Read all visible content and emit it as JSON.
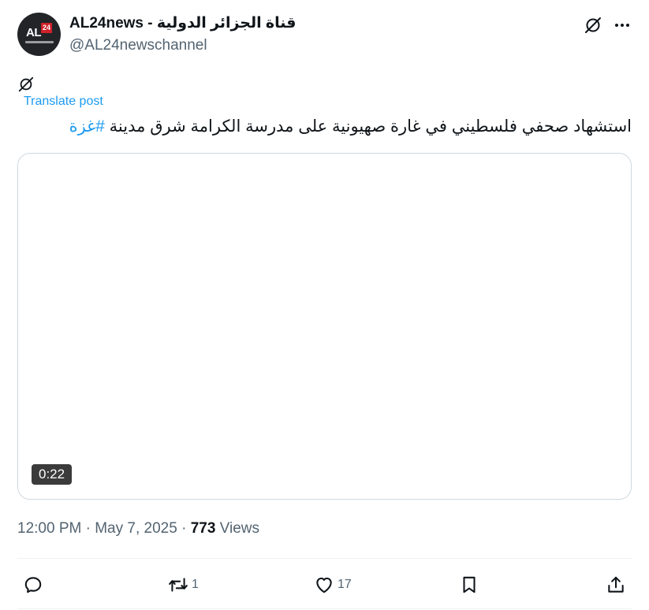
{
  "author": {
    "avatar_text": "AL",
    "avatar_badge": "24",
    "display_name": "AL24news - قناة الجزائر الدولية",
    "handle": "@AL24newschannel"
  },
  "post": {
    "translate_label": "Translate post",
    "text_main": "استشهاد صحفي فلسطيني في غارة صهيونية على مدرسة الكرامة شرق مدينة ",
    "hashtag": "#غزة"
  },
  "media": {
    "duration": "0:22"
  },
  "meta": {
    "time": "12:00 PM",
    "separator": "·",
    "date": "May 7, 2025",
    "views_count": "773",
    "views_label": "Views"
  },
  "actions": {
    "reply_count": "",
    "repost_count": "1",
    "like_count": "17"
  },
  "icons": {
    "grok": "grok-icon",
    "more": "more-icon",
    "reply": "reply-icon",
    "repost": "repost-icon",
    "like": "like-icon",
    "bookmark": "bookmark-icon",
    "share": "share-icon"
  },
  "colors": {
    "accent": "#1d9bf0",
    "text": "#0f1419",
    "muted": "#536471",
    "border": "#cfd9de"
  }
}
